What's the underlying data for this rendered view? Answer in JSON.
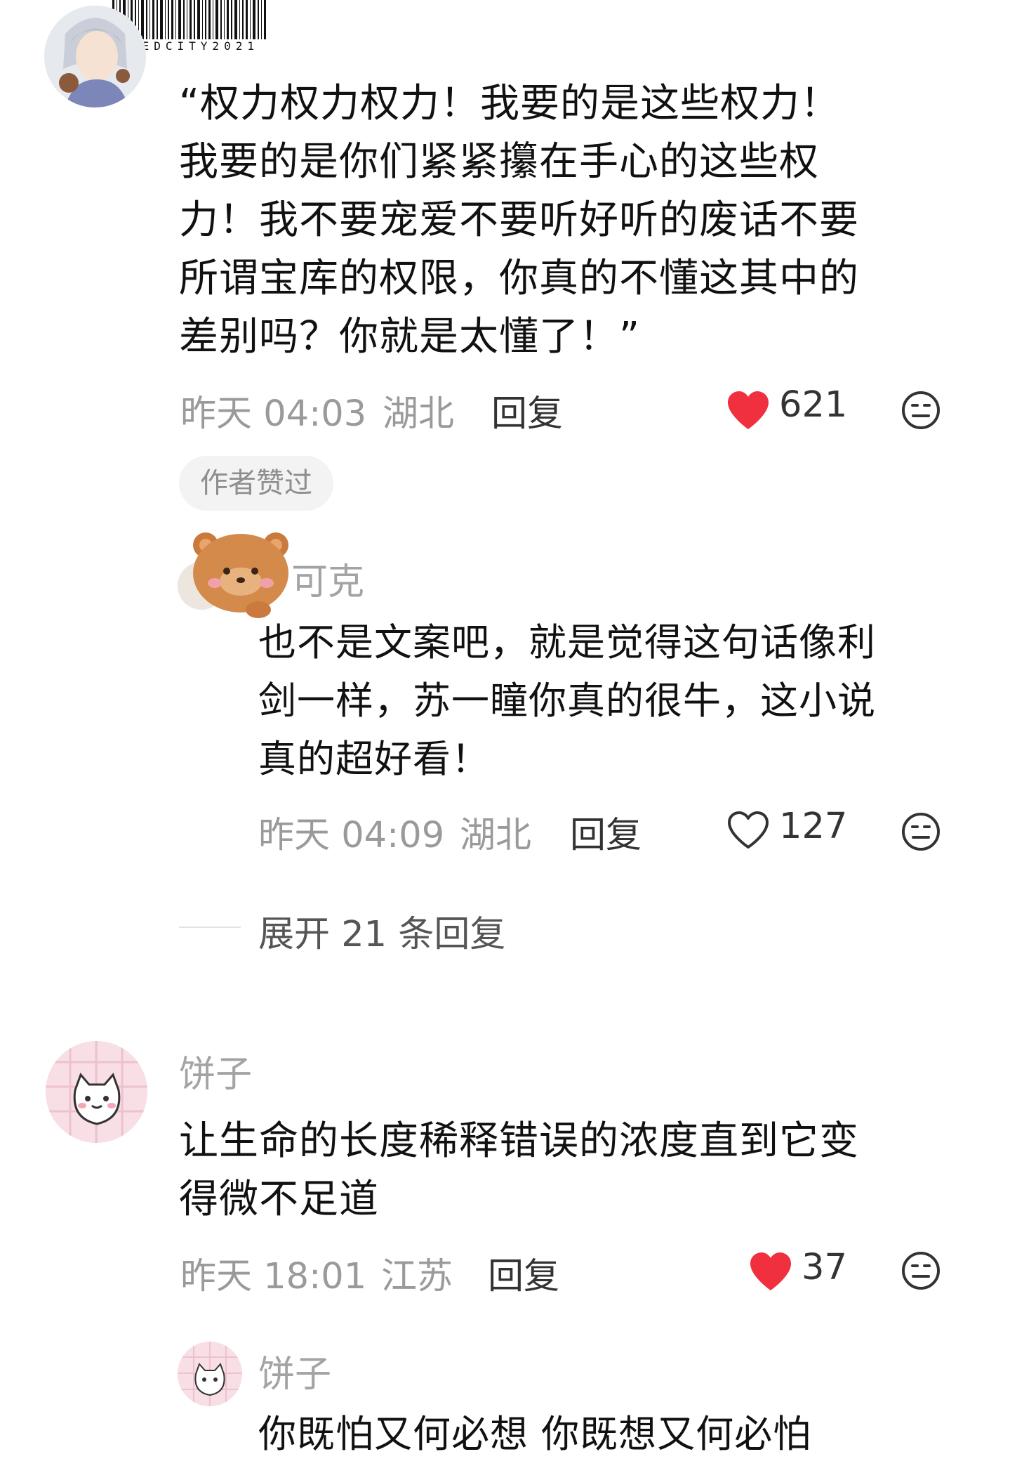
{
  "watermark": {
    "text": "REDCITY2021"
  },
  "comments": [
    {
      "text": "“权力权力权力！我要的是这些权力！\n我要的是你们紧紧攥在手心的这些权\n力！我不要宠爱不要听好听的废话不要\n所谓宝库的权限，你真的不懂这其中的\n差别吗？你就是太懂了！”",
      "time": "昨天 04:03",
      "location": "湖北",
      "reply_label": "回复",
      "likes": "621",
      "liked": true,
      "badge": "作者赞过",
      "replies": [
        {
          "username_partial": "可克",
          "text": "也不是文案吧，就是觉得这句话像利\n剑一样，苏一瞳你真的很牛，这小说\n真的超好看！",
          "time": "昨天 04:09",
          "location": "湖北",
          "reply_label": "回复",
          "likes": "127",
          "liked": false
        }
      ],
      "expand_label": "展开 21 条回复"
    },
    {
      "username": "饼子",
      "text": "让生命的长度稀释错误的浓度直到它变\n得微不足道",
      "time": "昨天 18:01",
      "location": "江苏",
      "reply_label": "回复",
      "likes": "37",
      "liked": true,
      "replies": [
        {
          "username": "饼子",
          "text": "你既怕又何必想 你既想又何必怕"
        }
      ]
    }
  ],
  "colors": {
    "heart_liked": "#f0303e",
    "meta_gray": "#9a9a9a",
    "body_text": "#111111"
  },
  "icons": {
    "like_filled": "heart-filled-icon",
    "like_outline": "heart-outline-icon",
    "dislike": "neutral-face-icon"
  }
}
